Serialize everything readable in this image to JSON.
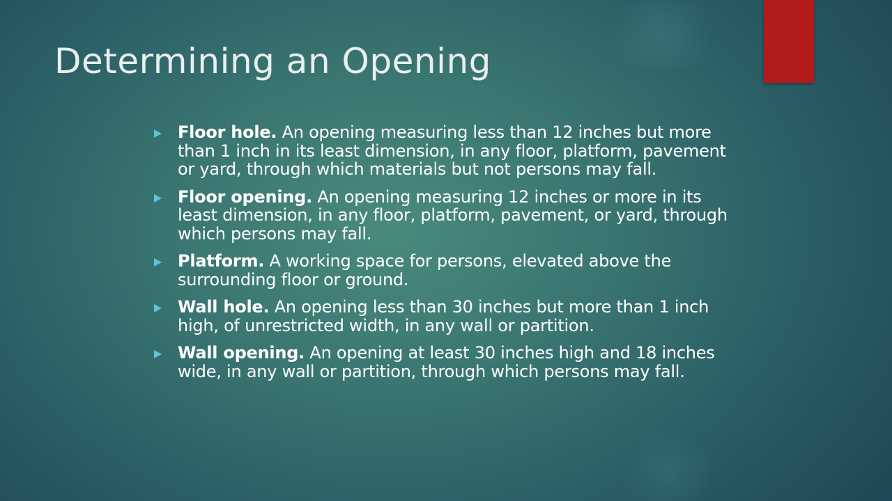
{
  "colors": {
    "accent_bar": "#b21b1b",
    "title_text": "#e9efee",
    "body_text": "#ffffff",
    "bullet_icon": "#5fc3d6"
  },
  "slide": {
    "title": "Determining an Opening",
    "bullets": [
      {
        "term": "Floor hole.",
        "definition": " An opening measuring less than 12 inches but more than 1 inch in its least dimension, in any floor, platform, pavement or yard, through which materials but not persons may fall."
      },
      {
        "term": "Floor opening.",
        "definition": " An opening measuring 12 inches or more in its least dimension, in any floor, platform, pavement, or yard, through which persons may fall."
      },
      {
        "term": "Platform.",
        "definition": " A working space for persons, elevated above the surrounding floor or ground."
      },
      {
        "term": "Wall hole.",
        "definition": " An opening less than 30 inches but more than 1 inch high, of unrestricted width, in any wall or partition."
      },
      {
        "term": "Wall opening.",
        "definition": " An opening at least 30 inches high and 18 inches wide, in any wall or partition, through which persons may fall."
      }
    ]
  }
}
